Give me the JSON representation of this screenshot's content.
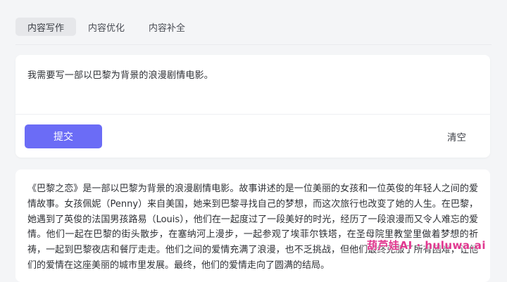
{
  "tabs": [
    {
      "label": "内容写作",
      "active": true
    },
    {
      "label": "内容优化",
      "active": false
    },
    {
      "label": "内容补全",
      "active": false
    }
  ],
  "input": {
    "text": "我需要写一部以巴黎为背景的浪漫剧情电影。"
  },
  "actions": {
    "submit_label": "提交",
    "clear_label": "清空"
  },
  "output": {
    "text": "《巴黎之恋》是一部以巴黎为背景的浪漫剧情电影。故事讲述的是一位美丽的女孩和一位英俊的年轻人之间的爱情故事。女孩佩妮（Penny）来自美国，她来到巴黎寻找自己的梦想，而这次旅行也改变了她的人生。在巴黎，她遇到了英俊的法国男孩路易（Louis），他们在一起度过了一段美好的时光，经历了一段浪漫而又令人难忘的爱情。他们一起在巴黎的街头散步，在塞纳河上漫步，一起参观了埃菲尔铁塔，在圣母院里教堂里做着梦想的祈祷，一起到巴黎夜店和餐厅走走。他们之间的爱情充满了浪漫，也不乏挑战，但他们最终克服了所有困难，让他们的爱情在这座美丽的城市里发展。最终，他们的爱情走向了圆满的结局。"
  },
  "watermark": "葫芦娃AI · huluwa.ai",
  "colors": {
    "accent": "#6b6cf6",
    "background": "#f4f5f7",
    "watermark": "#e0388f"
  }
}
